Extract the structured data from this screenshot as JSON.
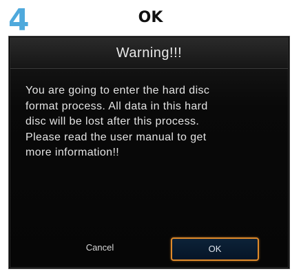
{
  "step": {
    "number": "4",
    "heading": "OK"
  },
  "dialog": {
    "title": "Warning!!!",
    "message": "You are going to enter the hard disc\nformat process. All data in this hard\ndisc will be lost after this process.\nPlease read the user manual to get\nmore information!!",
    "cancel_label": "Cancel",
    "ok_label": "OK"
  },
  "colors": {
    "step_number": "#4fa9dc",
    "focus_border": "#e08a2a",
    "dialog_background": "#060606",
    "ok_button_fill": "#0c2238"
  }
}
